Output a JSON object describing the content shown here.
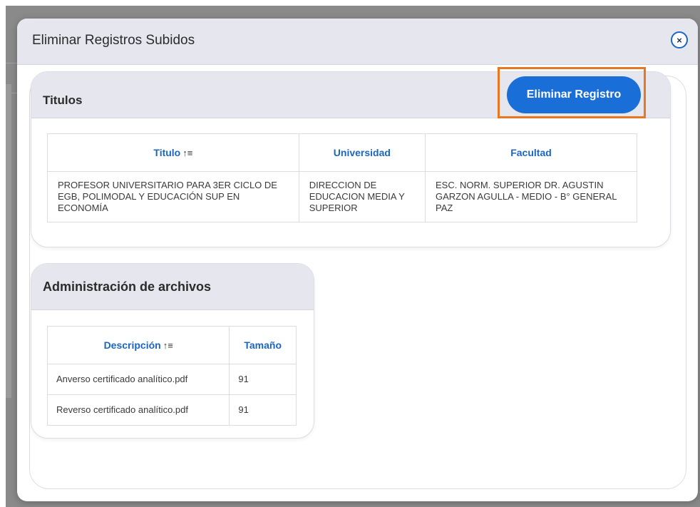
{
  "modal": {
    "title": "Eliminar Registros Subidos",
    "close_label": "×"
  },
  "titulos": {
    "title": "Titulos",
    "delete_button": "Eliminar Registro",
    "columns": [
      "Titulo",
      "Universidad",
      "Facultad"
    ],
    "sort_icon": "↑≡",
    "rows": [
      {
        "titulo": "PROFESOR UNIVERSITARIO PARA 3ER CICLO DE EGB, POLIMODAL Y EDUCACIÓN SUP EN ECONOMÍA",
        "universidad": "DIRECCION DE EDUCACION MEDIA Y SUPERIOR",
        "facultad": "ESC. NORM. SUPERIOR DR. AGUSTIN GARZON AGULLA - MEDIO - B° GENERAL PAZ"
      }
    ]
  },
  "archivos": {
    "title": "Administración de archivos",
    "columns": [
      "Descripción",
      "Tamaño"
    ],
    "sort_icon": "↑≡",
    "rows": [
      {
        "descripcion": "Anverso certificado analítico.pdf",
        "tamano": "91"
      },
      {
        "descripcion": "Reverso certificado analítico.pdf",
        "tamano": "91"
      }
    ]
  },
  "colors": {
    "accent": "#1a6ed8",
    "highlight": "#e87722",
    "header_bg": "#e6e7ee"
  }
}
